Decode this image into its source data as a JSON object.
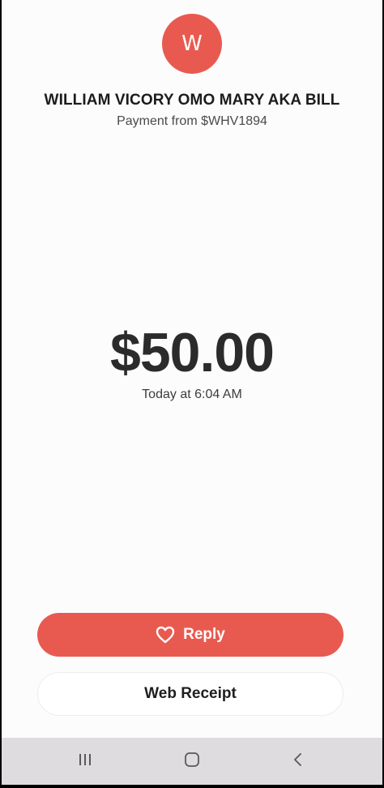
{
  "contact": {
    "avatar_initial": "W",
    "name": "WILLIAM VICORY OMO MARY AKA BILL",
    "subtitle": "Payment from $WHV1894"
  },
  "payment": {
    "amount": "$50.00",
    "time": "Today at 6:04 AM"
  },
  "actions": {
    "reply_label": "Reply",
    "reply_icon": "heart-icon",
    "web_receipt_label": "Web Receipt"
  },
  "nav_bar": {
    "icons": [
      "recent-apps-icon",
      "home-icon",
      "back-icon"
    ]
  },
  "colors": {
    "accent": "#e85a50",
    "background": "#fdfcfd",
    "nav_bar": "#dedcde"
  }
}
